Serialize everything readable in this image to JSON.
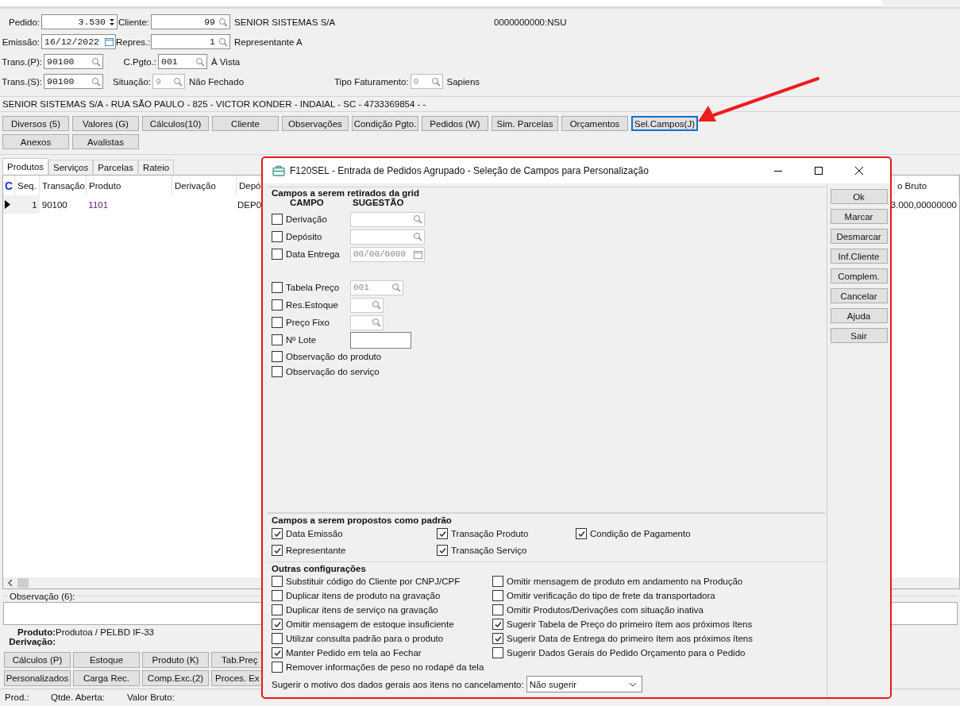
{
  "header": {
    "order": {
      "label": "Pedido:",
      "value": "3.530"
    },
    "client": {
      "label": "Cliente:",
      "value": "99",
      "name": "SENIOR SISTEMAS S/A"
    },
    "nsu": "0000000000:NSU",
    "issue_date": {
      "label": "Emissão:",
      "value": "16/12/2022"
    },
    "representative": {
      "label": "Repres.:",
      "value": "1",
      "name": "Representante A"
    },
    "transaction_p": {
      "label": "Trans.(P):",
      "value": "90100"
    },
    "payment": {
      "label": "C.Pgto.:",
      "value": "001",
      "name": "À Vista"
    },
    "transaction_s": {
      "label": "Trans.(S):",
      "value": "90100"
    },
    "situation": {
      "label": "Situação:",
      "value": "9",
      "name": "Não Fechado",
      "disabled": true
    },
    "billing_type": {
      "label": "Tipo Faturamento:",
      "value": "0",
      "name": "Sapiens",
      "disabled": true
    }
  },
  "address": "SENIOR SISTEMAS S/A - RUA SÃO PAULO - 825 - VICTOR KONDER - INDAIAL - SC - 4733369854 -   -",
  "action_rows": [
    [
      {
        "label": "Diversos (5)",
        "focused": false
      },
      {
        "label": "Valores (G)",
        "focused": false
      },
      {
        "label": "Cálculos(10)",
        "focused": false
      },
      {
        "label": "Cliente",
        "focused": false
      },
      {
        "label": "Observações",
        "focused": false
      },
      {
        "label": "Condição Pgto.",
        "focused": false
      },
      {
        "label": "Pedidos (W)",
        "focused": false
      },
      {
        "label": "Sim. Parcelas",
        "focused": false
      },
      {
        "label": "Orçamentos",
        "focused": false
      },
      {
        "label": "Sel.Campos(J)",
        "focused": true
      }
    ],
    [
      {
        "label": "Anexos",
        "focused": false
      },
      {
        "label": "Avalistas",
        "focused": false
      }
    ]
  ],
  "tabs": [
    {
      "label": "Produtos",
      "selected": true
    },
    {
      "label": "Serviços",
      "selected": false
    },
    {
      "label": "Parcelas",
      "selected": false
    },
    {
      "label": "Rateio",
      "selected": false
    }
  ],
  "grid": {
    "columns": [
      "C",
      "Seq.",
      "Transação",
      "Produto",
      "Derivação",
      "Depó",
      "o Bruto"
    ],
    "rows": [
      {
        "current": true,
        "seq": "1",
        "transaction": "90100",
        "product": "1101",
        "deposit": "DEP0",
        "gross": "3.000,00000000"
      }
    ]
  },
  "observation": {
    "label": "Observação (6):"
  },
  "product_info": {
    "product_label": "Produto:",
    "product": "Produtoa / PELBD IF-33",
    "derivation_label": "Derivação:"
  },
  "bottom_rows": [
    [
      "Cálculos (P)",
      "Estoque",
      "Produto (K)",
      "Tab.Preç"
    ],
    [
      "Personalizados",
      "Carga Rec.",
      "Comp.Exc.(2)",
      "Proces. Ex"
    ]
  ],
  "totals": [
    "Prod.:",
    "Qtde. Aberta:",
    "Valor Bruto:"
  ],
  "dialog": {
    "title": "F120SEL - Entrada de Pedidos Agrupado - Seleção de Campos para Personalização",
    "grid_fields": {
      "title": "Campos a serem retirados da grid",
      "headers": [
        "CAMPO",
        "SUGESTÃO"
      ],
      "blocks": [
        [
          {
            "label": "Derivação",
            "checked": false,
            "field": {
              "kind": "search"
            }
          },
          {
            "label": "Depósito",
            "checked": false,
            "field": {
              "kind": "search"
            }
          },
          {
            "label": "Data Entrega",
            "checked": false,
            "field": {
              "kind": "date",
              "value": "00/00/0000",
              "disabled": true
            }
          }
        ],
        [
          {
            "label": "Tabela Preço",
            "checked": false,
            "field": {
              "kind": "search",
              "value": "001",
              "disabled": true
            }
          },
          {
            "label": "Res.Estoque",
            "checked": false,
            "field": {
              "kind": "search"
            }
          },
          {
            "label": "Preço Fixo",
            "checked": false,
            "field": {
              "kind": "search"
            }
          },
          {
            "label": "Nº Lote",
            "checked": false,
            "field": {
              "kind": "text"
            }
          },
          {
            "label": "Observação do produto",
            "checked": false
          },
          {
            "label": "Observação do serviço",
            "checked": false
          }
        ]
      ]
    },
    "defaults": {
      "title": "Campos a serem propostos como padrão",
      "items": [
        {
          "label": "Data Emissão",
          "checked": true
        },
        {
          "label": "Transação Produto",
          "checked": true
        },
        {
          "label": "Condição de Pagamento",
          "checked": true
        },
        {
          "label": "Representante",
          "checked": true
        },
        {
          "label": "Transação Serviço",
          "checked": true
        }
      ]
    },
    "other": {
      "title": "Outras configurações",
      "left": [
        {
          "label": "Substituir código do Cliente por CNPJ/CPF",
          "checked": false
        },
        {
          "label": "Duplicar itens de produto na gravação",
          "checked": false
        },
        {
          "label": "Duplicar itens de serviço na gravação",
          "checked": false
        },
        {
          "label": "Omitir mensagem de estoque insuficiente",
          "checked": true
        },
        {
          "label": "Utilizar consulta padrão para o produto",
          "checked": false
        },
        {
          "label": "Manter Pedido em tela ao Fechar",
          "checked": true
        },
        {
          "label": "Remover informações de peso no rodapé da tela",
          "checked": false
        }
      ],
      "right": [
        {
          "label": "Omitir mensagem de produto em andamento na Produção",
          "checked": false
        },
        {
          "label": "Omitir verificação do tipo de frete da transportadora",
          "checked": false
        },
        {
          "label": "Omitir Produtos/Derivações com situação inativa",
          "checked": false
        },
        {
          "label": "Sugerir Tabela de Preço do primeiro ítem aos próximos ítens",
          "checked": true
        },
        {
          "label": "Sugerir Data de Entrega do primeiro ítem aos próximos ítens",
          "checked": true
        },
        {
          "label": "Sugerir Dados Gerais do Pedido Orçamento para o Pedido",
          "checked": false
        }
      ],
      "reason": {
        "label": "Sugerir o motivo dos dados gerais aos itens no cancelamento:",
        "value": "Não sugerir"
      }
    },
    "buttons": [
      "Ok",
      "Marcar",
      "Desmarcar",
      "Inf.Cliente",
      "Complem.",
      "Cancelar",
      "Ajuda",
      "Sair"
    ]
  }
}
